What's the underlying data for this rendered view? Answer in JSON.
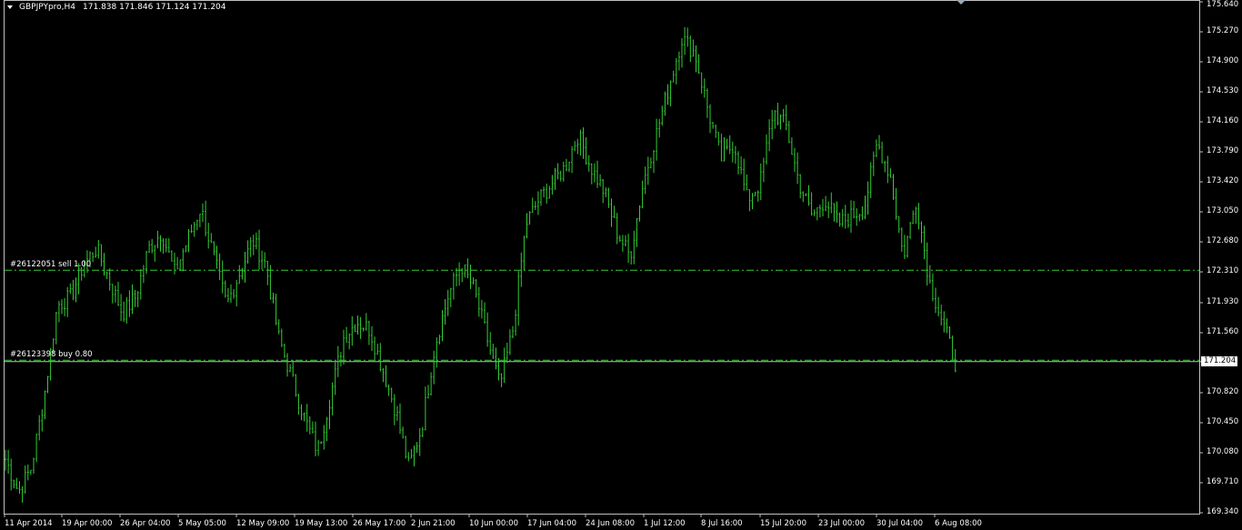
{
  "window": {
    "symbol_timeframe": "GBPJPYpro,H4",
    "ohlc": "171.838 171.846 171.124 171.204"
  },
  "colors": {
    "background": "#000000",
    "candles": "#33cc33",
    "order_line": "#33cc33",
    "frame": "#c0c0c0",
    "text": "#ffffff"
  },
  "orders": [
    {
      "label": "#26122051 sell 1.00",
      "price": 172.33
    },
    {
      "label": "#26123398 buy 0.80",
      "price": 171.22
    }
  ],
  "current_price": {
    "label": "171.204",
    "price": 171.204
  },
  "price_axis": {
    "ticks": [
      "175.640",
      "175.270",
      "174.900",
      "174.530",
      "174.160",
      "173.790",
      "173.420",
      "173.050",
      "172.680",
      "172.310",
      "171.930",
      "171.560",
      "171.204",
      "170.820",
      "170.450",
      "170.080",
      "169.710",
      "169.340"
    ]
  },
  "time_axis": {
    "ticks": [
      "11 Apr 2014",
      "19 Apr 00:00",
      "26 Apr 04:00",
      "5 May 05:00",
      "12 May 09:00",
      "19 May 13:00",
      "26 May 17:00",
      "2 Jun 21:00",
      "10 Jun 00:00",
      "17 Jun 04:00",
      "24 Jun 08:00",
      "1 Jul 12:00",
      "8 Jul 16:00",
      "15 Jul 20:00",
      "23 Jul 00:00",
      "30 Jul 04:00",
      "6 Aug 08:00"
    ]
  },
  "chart_data": {
    "type": "line",
    "series": [
      {
        "values": [
          170.0,
          169.6,
          169.9,
          170.8,
          171.9,
          172.0,
          172.4,
          172.6,
          172.2,
          171.8,
          172.0,
          172.6,
          172.8,
          172.3,
          172.7,
          173.1,
          172.5,
          171.9,
          172.3,
          172.7,
          172.4,
          171.5,
          171.0,
          170.5,
          170.1,
          170.8,
          171.5,
          171.7,
          171.6,
          171.1,
          170.6,
          169.9,
          170.4,
          171.4,
          172.0,
          172.4,
          172.1,
          171.5,
          170.9,
          171.6,
          172.9,
          173.2,
          173.4,
          173.6,
          174.0,
          173.6,
          173.3,
          172.8,
          172.5,
          173.4,
          174.0,
          174.6,
          175.2,
          175.0,
          174.3,
          173.7,
          173.9,
          173.2,
          173.4,
          174.3,
          174.1,
          173.4,
          173.0,
          173.2,
          172.9,
          173.0,
          173.1,
          173.9,
          173.5,
          172.5,
          173.2,
          172.2,
          171.7,
          171.2
        ]
      }
    ],
    "ylim": [
      169.34,
      175.64
    ]
  }
}
